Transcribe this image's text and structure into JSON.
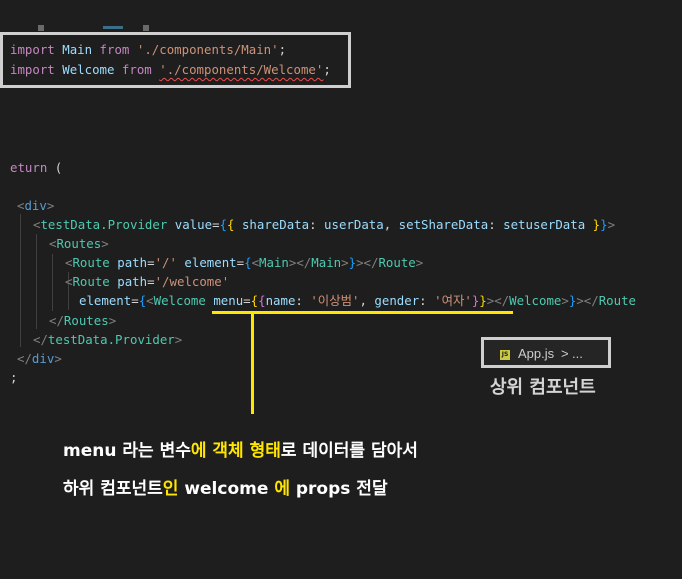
{
  "import_box": {
    "line1": {
      "keyword": "import",
      "name": "Main",
      "from": "from",
      "path": "'./components/Main'",
      "semi": ";"
    },
    "line2": {
      "keyword": "import",
      "name": "Welcome",
      "from": "from",
      "path": "'./components/Welcome'",
      "semi": ";"
    }
  },
  "code": {
    "return_line": {
      "keyword": "eturn",
      "paren": " ("
    },
    "div_open": {
      "open": "<",
      "tag": "div",
      "close": ">"
    },
    "provider_open": {
      "open": "<",
      "tag": "testData.Provider",
      "attr": "value",
      "eq": "=",
      "b1": "{",
      "b2": "{",
      "key1": "shareData",
      "colon1": ":",
      "val1": "userData",
      "comma": ",",
      "key2": "setShareData",
      "colon2": ":",
      "val2": "setuserData",
      "b2c": "}",
      "b1c": "}",
      "close": ">"
    },
    "routes_open": {
      "open": "<",
      "tag": "Routes",
      "close": ">"
    },
    "route1": {
      "open": "<",
      "tag": "Route",
      "attr1": "path",
      "eq": "=",
      "path": "'/'",
      "attr2": "element",
      "b1": "{",
      "el_open": "<",
      "el_tag": "Main",
      "el_mid": "></",
      "el_tag2": "Main",
      "el_close": ">",
      "b1c": "}",
      "close_open": "></",
      "close_tag": "Route",
      "close": ">"
    },
    "route2_a": {
      "open": "<",
      "tag": "Route",
      "attr1": "path",
      "eq": "=",
      "path": "'/welcome'"
    },
    "route2_b": {
      "attr": "element",
      "eq": "=",
      "b1": "{",
      "el_open": "<",
      "el_tag": "Welcome",
      "prop": "menu",
      "peq": "=",
      "b2": "{",
      "b3": "{",
      "k1": "name",
      "c1": ":",
      "v1": "'이상범'",
      "comma": ",",
      "k2": "gender",
      "c2": ":",
      "v2": "'여자'",
      "b3c": "}",
      "b2c": "}",
      "el_mid": "></",
      "el_tag2": "Welcome",
      "el_close": ">",
      "b1c": "}",
      "close_open": "></",
      "close_tag": "Route"
    },
    "routes_close": {
      "open": "</",
      "tag": "Routes",
      "close": ">"
    },
    "provider_close": {
      "open": "</",
      "tag": "testData.Provider",
      "close": ">"
    },
    "div_close": {
      "open": "</",
      "tag": "div",
      "close": ">"
    },
    "semicolon": ";"
  },
  "breadcrumb": {
    "icon": "js-file-icon",
    "icon_text": "JS",
    "file": "App.js",
    "separator": ">",
    "more": "..."
  },
  "labels": {
    "parent_component": "상위 컴포넌트",
    "line1": {
      "w1": "menu 라는 변수",
      "y1": "에 객체 형태",
      "w2": "로 데이터를 담아서"
    },
    "line2": {
      "w1": "하위 컴포넌트",
      "y1": "인",
      "w2": " welcome ",
      "y2": "에",
      "w3": " props 전달"
    }
  },
  "colors": {
    "background": "#1e1e1e",
    "highlight": "#ffe600",
    "frame": "#cfcfcf"
  }
}
